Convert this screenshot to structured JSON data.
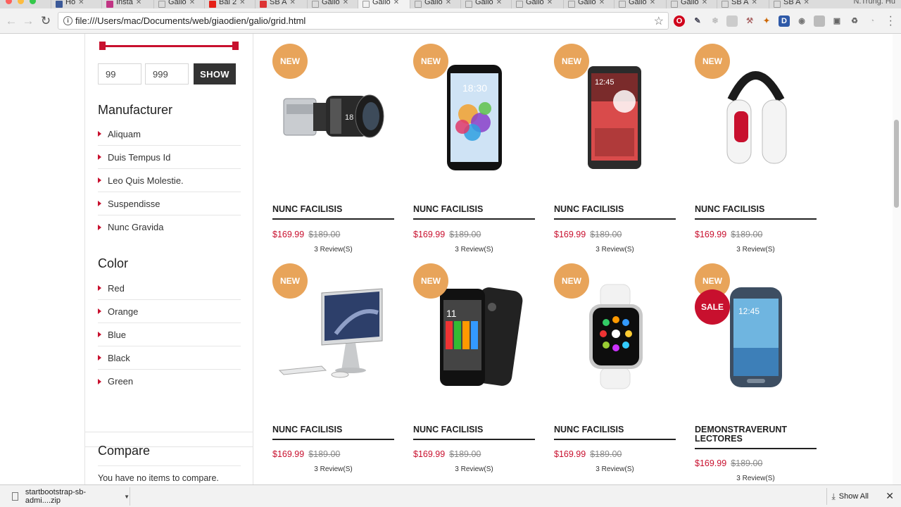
{
  "browser": {
    "tabs": [
      {
        "label": "Ho"
      },
      {
        "label": "Insta"
      },
      {
        "label": "Galio"
      },
      {
        "label": "Bai 2"
      },
      {
        "label": "SB A"
      },
      {
        "label": "Galio"
      },
      {
        "label": "Galio"
      },
      {
        "label": "Galio"
      },
      {
        "label": "Galio"
      },
      {
        "label": "Galio"
      },
      {
        "label": "Galio"
      },
      {
        "label": "Galio"
      },
      {
        "label": "Galio"
      },
      {
        "label": "SB A"
      },
      {
        "label": "SB A"
      }
    ],
    "profile_name": "N.Trung. Hu",
    "url": "file:///Users/mac/Documents/web/giaodien/galio/grid.html",
    "icons": {
      "back": "back-arrow-icon",
      "forward": "forward-arrow-icon",
      "reload": "reload-icon",
      "info": "info-icon",
      "bookmark": "star-icon"
    },
    "extension_colors": {
      "opera": "#d0021b",
      "d": "#2f5aa8"
    }
  },
  "sidebar": {
    "price_filter": {
      "min_value": "99",
      "max_value": "999",
      "range_fill": 1.0,
      "button_label": "SHOW",
      "accent_color": "#c8102e"
    },
    "manufacturer": {
      "title": "Manufacturer",
      "items": [
        {
          "label": "Aliquam"
        },
        {
          "label": "Duis Tempus Id"
        },
        {
          "label": "Leo Quis Molestie."
        },
        {
          "label": "Suspendisse"
        },
        {
          "label": "Nunc Gravida"
        }
      ]
    },
    "color": {
      "title": "Color",
      "items": [
        {
          "label": "Red"
        },
        {
          "label": "Orange"
        },
        {
          "label": "Blue"
        },
        {
          "label": "Black"
        },
        {
          "label": "Green"
        }
      ]
    },
    "compare": {
      "title": "Compare",
      "text": "You have no items to compare."
    }
  },
  "products": [
    {
      "name": "NUNC FACILISIS",
      "price": "$169.99",
      "old_price": "$189.00",
      "reviews": "3 Review(S)",
      "badges": [
        "NEW"
      ],
      "image": "cinema-camera"
    },
    {
      "name": "NUNC FACILISIS",
      "price": "$169.99",
      "old_price": "$189.00",
      "reviews": "3 Review(S)",
      "badges": [
        "NEW"
      ],
      "image": "smartphone-white"
    },
    {
      "name": "NUNC FACILISIS",
      "price": "$169.99",
      "old_price": "$189.00",
      "reviews": "3 Review(S)",
      "badges": [
        "NEW"
      ],
      "image": "smartphone-note"
    },
    {
      "name": "NUNC FACILISIS",
      "price": "$169.99",
      "old_price": "$189.00",
      "reviews": "3 Review(S)",
      "badges": [
        "NEW"
      ],
      "image": "headphones"
    },
    {
      "name": "NUNC FACILISIS",
      "price": "$169.99",
      "old_price": "$189.00",
      "reviews": "3 Review(S)",
      "badges": [
        "NEW"
      ],
      "image": "imac"
    },
    {
      "name": "NUNC FACILISIS",
      "price": "$169.99",
      "old_price": "$189.00",
      "reviews": "3 Review(S)",
      "badges": [
        "NEW"
      ],
      "image": "moto-phone"
    },
    {
      "name": "NUNC FACILISIS",
      "price": "$169.99",
      "old_price": "$189.00",
      "reviews": "3 Review(S)",
      "badges": [
        "NEW"
      ],
      "image": "smartwatch"
    },
    {
      "name": "DEMONSTRAVERUNT LECTORES",
      "price": "$169.99",
      "old_price": "$189.00",
      "reviews": "3 Review(S)",
      "badges": [
        "NEW",
        "SALE"
      ],
      "image": "galaxy-phone"
    }
  ],
  "colors": {
    "new_badge": "#e8a45a",
    "sale_badge": "#c8102e",
    "price": "#c8102e"
  },
  "downloads": {
    "item_name": "startbootstrap-sb-admi....zip",
    "show_all_label": "Show All"
  }
}
